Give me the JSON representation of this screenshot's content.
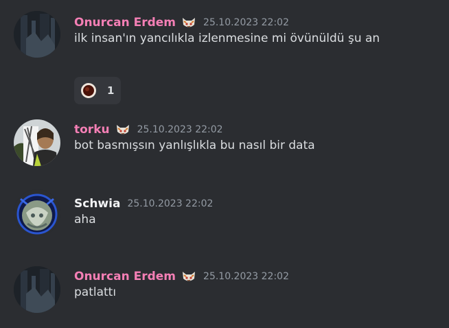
{
  "colors": {
    "background": "#2b2d31",
    "pink_name": "#f47fb5",
    "white_name": "#f2f3f5",
    "timestamp": "#949ba4",
    "text": "#dbdee1"
  },
  "messages": [
    {
      "author": "Onurcan Erdem",
      "timestamp": "25.10.2023 22:02",
      "text": "ilk insan'ın yancılıkla izlenmesine mi övünüldü şu an",
      "reaction": {
        "icon": "cookie-icon",
        "count": "1"
      }
    },
    {
      "author": "torku",
      "timestamp": "25.10.2023 22:02",
      "text": "bot basmışsın yanlışlıkla bu nasıl bir data"
    },
    {
      "author": "Schwia",
      "timestamp": "25.10.2023 22:02",
      "text": "aha"
    },
    {
      "author": "Onurcan Erdem",
      "timestamp": "25.10.2023 22:02",
      "text": "patlattı"
    }
  ]
}
